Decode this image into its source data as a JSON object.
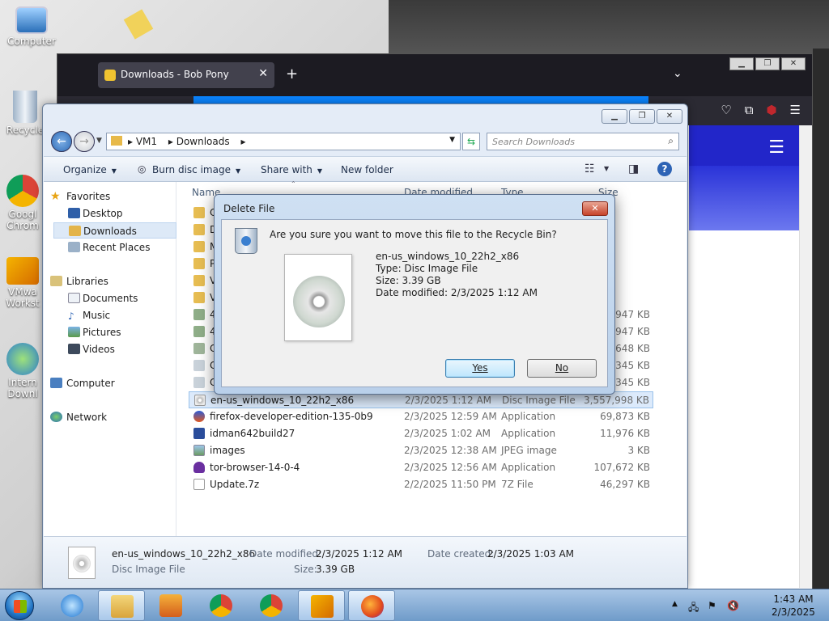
{
  "desktop": {
    "icons": [
      {
        "label": "Computer"
      },
      {
        "label": "Recycle"
      },
      {
        "label": "Googl"
      },
      {
        "label": "Chrom"
      },
      {
        "label": "VMwa"
      },
      {
        "label": "Workst"
      },
      {
        "label": "Intern"
      },
      {
        "label": "Downl"
      }
    ]
  },
  "firefox": {
    "tab_title": "Downloads - Bob Pony",
    "tab_close": "✕",
    "new_tab": "+",
    "list_tabs": "⌄",
    "menu": "☰",
    "win_btns": [
      "▁",
      "❐",
      "✕"
    ]
  },
  "explorer": {
    "win_btns": [
      "▁",
      "❐",
      "✕"
    ],
    "breadcrumb": [
      "VM1",
      "Downloads"
    ],
    "search_placeholder": "Search Downloads",
    "toolbar": {
      "organize": "Organize",
      "burn": "Burn disc image",
      "share": "Share with",
      "new_folder": "New folder"
    },
    "nav": {
      "favorites": "Favorites",
      "desktop": "Desktop",
      "downloads": "Downloads",
      "recent": "Recent Places",
      "libraries": "Libraries",
      "documents": "Documents",
      "music": "Music",
      "pictures": "Pictures",
      "videos": "Videos",
      "computer": "Computer",
      "network": "Network"
    },
    "columns": {
      "name": "Name",
      "date": "Date modified",
      "type": "Type",
      "size": "Size"
    },
    "partial_rows": [
      {
        "name": "C",
        "size": ""
      },
      {
        "name": "D",
        "size": ""
      },
      {
        "name": "M",
        "size": ""
      },
      {
        "name": "P",
        "size": ""
      },
      {
        "name": "V",
        "size": ""
      },
      {
        "name": "V",
        "size": ""
      },
      {
        "name": "4",
        "size": "3,947 KB"
      },
      {
        "name": "4",
        "size": "3,947 KB"
      },
      {
        "name": "C",
        "size": "1,648 KB"
      },
      {
        "name": "C",
        "size": "1,345 KB"
      },
      {
        "name": "C",
        "size": "1,345 KB"
      }
    ],
    "rows": [
      {
        "name": "en-us_windows_10_22h2_x86",
        "date": "2/3/2025 1:12 AM",
        "type": "Disc Image File",
        "size": "3,557,998 KB"
      },
      {
        "name": "firefox-developer-edition-135-0b9",
        "date": "2/3/2025 12:59 AM",
        "type": "Application",
        "size": "69,873 KB"
      },
      {
        "name": "idman642build27",
        "date": "2/3/2025 1:02 AM",
        "type": "Application",
        "size": "11,976 KB"
      },
      {
        "name": "images",
        "date": "2/3/2025 12:38 AM",
        "type": "JPEG image",
        "size": "3 KB"
      },
      {
        "name": "tor-browser-14-0-4",
        "date": "2/3/2025 12:56 AM",
        "type": "Application",
        "size": "107,672 KB"
      },
      {
        "name": "Update.7z",
        "date": "2/2/2025 11:50 PM",
        "type": "7Z File",
        "size": "46,297 KB"
      }
    ],
    "details": {
      "name": "en-us_windows_10_22h2_x86",
      "type": "Disc Image File",
      "modified_label": "Date modified:",
      "modified": "2/3/2025 1:12 AM",
      "size_label": "Size:",
      "size": "3.39 GB",
      "created_label": "Date created:",
      "created": "2/3/2025 1:03 AM"
    }
  },
  "dialog": {
    "title": "Delete File",
    "close": "✕",
    "question": "Are you sure you want to move this file to the Recycle Bin?",
    "file_name": "en-us_windows_10_22h2_x86",
    "file_type": "Type: Disc Image File",
    "file_size": "Size: 3.39 GB",
    "file_date": "Date modified: 2/3/2025 1:12 AM",
    "yes": "Yes",
    "no": "No"
  },
  "taskbar": {
    "time": "1:43 AM",
    "date": "2/3/2025",
    "tray_arrow": "▲"
  }
}
